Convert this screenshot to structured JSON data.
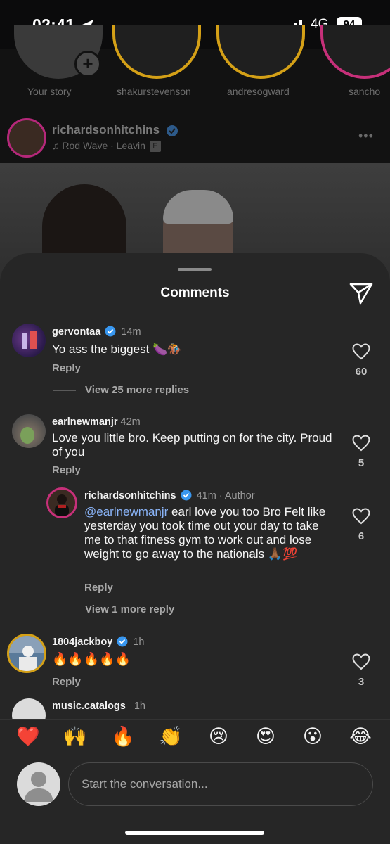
{
  "status_bar": {
    "time": "02:41",
    "network": "4G",
    "battery": "94"
  },
  "stories": [
    {
      "label": "Your story"
    },
    {
      "label": "shakurstevenson"
    },
    {
      "label": "andresogward"
    },
    {
      "label": "sancho"
    }
  ],
  "post": {
    "username": "richardsonhitchins",
    "song": "Rod Wave · Leavin",
    "explicit_badge": "E"
  },
  "sheet": {
    "title": "Comments"
  },
  "comments": [
    {
      "username": "gervontaa",
      "time": "14m",
      "text": "Yo ass the biggest 🍆🏇",
      "reply_label": "Reply",
      "likes": "60",
      "view_more": "View 25 more replies"
    },
    {
      "username": "earlnewmanjr",
      "time": "42m",
      "text": "Love you little bro. Keep putting on for the city. Proud of you",
      "reply_label": "Reply",
      "likes": "5"
    },
    {
      "username": "richardsonhitchins",
      "time": "41m · Author",
      "mention": "@earlnewmanjr",
      "text": " earl love you too Bro Felt like yesterday you took time out your day to take me to that fitness gym to work out and lose weight to go away to the nationals 🙏🏾💯",
      "reply_label": "Reply",
      "likes": "6",
      "view_more": "View 1 more reply"
    },
    {
      "username": "1804jackboy",
      "time": "1h",
      "text": "🔥🔥🔥🔥🔥",
      "reply_label": "Reply",
      "likes": "3"
    },
    {
      "username": "music.catalogs_",
      "time": "1h"
    }
  ],
  "emoji_reactions": [
    "❤️",
    "🙌",
    "🔥",
    "👏",
    "😢",
    "😍",
    "😮",
    "😂"
  ],
  "composer": {
    "placeholder": "Start the conversation..."
  },
  "colors": {
    "sheet_bg": "#262626",
    "verified": "#3897f0",
    "mention": "#8ab4f8"
  }
}
